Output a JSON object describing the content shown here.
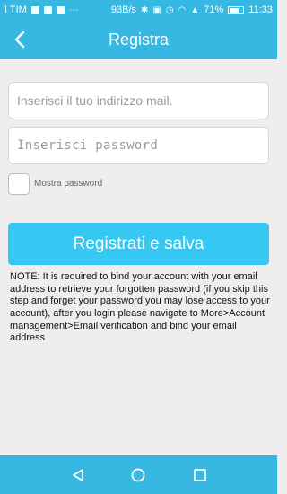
{
  "status_bar": {
    "carrier": "I TIM",
    "speed": "93B/s",
    "battery": "71%",
    "time": "11:33",
    "battery_level": 0.71
  },
  "header": {
    "title": "Registra",
    "back_icon": "chevron-left-icon"
  },
  "form": {
    "email_placeholder": "Inserisci il tuo indirizzo mail.",
    "password_placeholder": "Inserisci password",
    "show_password_label": "Mostra password",
    "submit_label": "Registrati e salva"
  },
  "note": {
    "text": "NOTE: It is required to bind your account with your email address to retrieve your forgotten password (if you skip this step and forget your password you may lose access to your account), after you login please navigate to More>Account management>Email verification and bind your email address"
  },
  "nav": {
    "back_icon": "triangle-back-icon",
    "home_icon": "circle-home-icon",
    "recent_icon": "square-recent-icon"
  },
  "colors": {
    "primary": "#36b8e3",
    "button": "#36c8f2",
    "background": "#eeeeee"
  }
}
